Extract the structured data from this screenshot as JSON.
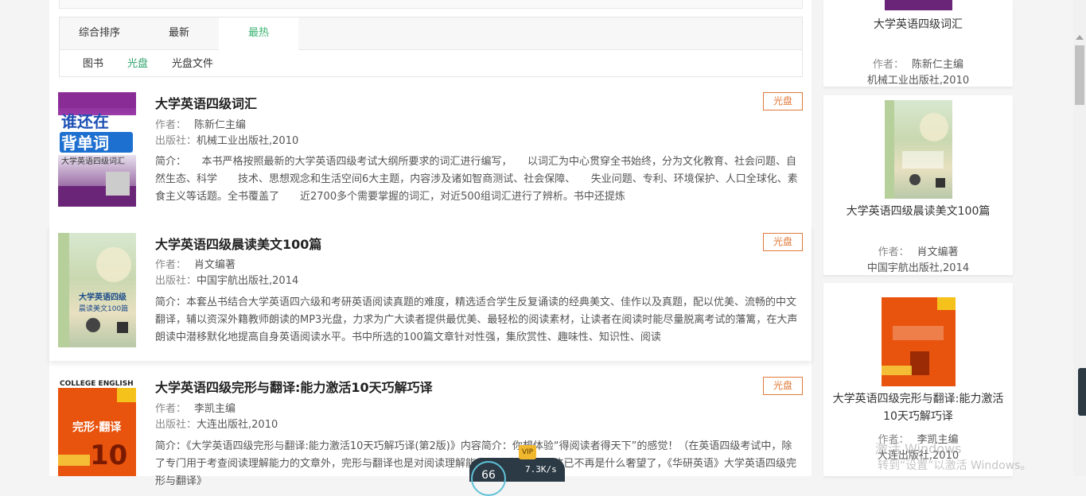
{
  "sort_tabs": [
    "综合排序",
    "最新",
    "最热"
  ],
  "active_sort": "最热",
  "filters": [
    "图书",
    "光盘",
    "光盘文件"
  ],
  "active_filter": "光盘",
  "labels": {
    "author": "作者：",
    "publisher": "出版社：",
    "intro": "简介："
  },
  "books": [
    {
      "title": "大学英语四级词汇",
      "author": "陈新仁主编",
      "publisher": "机械工业出版社,2010",
      "tag": "光盘",
      "intro": "　　本书严格按照最新的大学英语四级考试大纲所要求的词汇进行编写，　　以词汇为中心贯穿全书始终，分为文化教育、社会问题、自然生态、科学　　技术、思想观念和生活空间6大主题，内容涉及诸如智商测试、社会保障、　　失业问题、专利、环境保护、人口全球化、素食主义等话题。全书覆盖了　　近2700多个需要掌握的词汇，对近500组词汇进行了辨析。书中还提炼",
      "cover_text": [
        "谁还在",
        "背单词",
        "大学英语四级词汇"
      ]
    },
    {
      "title": "大学英语四级晨读美文100篇",
      "author": "肖文编著",
      "publisher": "中国宇航出版社,2014",
      "tag": "光盘",
      "intro": "本套丛书结合大学英语四六级和考研英语阅读真题的难度，精选适合学生反复诵读的经典美文、佳作以及真题，配以优美、流畅的中文翻译，辅以资深外籍教师朗读的MP3光盘，力求为广大读者提供最优美、最轻松的阅读素材，让读者在阅读时能尽量脱离考试的藩篱，在大声朗读中潜移默化地提高自身英语阅读水平。书中所选的100篇文章针对性强，集欣赏性、趣味性、知识性、阅读",
      "cover_text": [
        "大学英语四级",
        "晨读美文100篇"
      ]
    },
    {
      "title": "大学英语四级完形与翻译:能力激活10天巧解巧译",
      "author": "李凯主编",
      "publisher": "大连出版社,2010",
      "tag": "光盘",
      "intro": "《大学英语四级完形与翻译:能力激活10天巧解巧译(第2版)》内容简介：你想体验“得阅读者得天下”的感觉！（在英语四级考试中，除了专门用于考查阅读理解能力的文章外，完形与翻译也是对阅读理解能力的考查。）现在这已不再是什么奢望了，《华研英语》大学英语四级完形与翻译》",
      "cover_text": [
        "COLLEGE ENGLISH",
        "完形·翻译",
        "10"
      ]
    }
  ],
  "sidebar": [
    {
      "title": "大学英语四级词汇",
      "author": "陈新仁主编",
      "publisher": "机械工业出版社,2010"
    },
    {
      "title": "大学英语四级晨读美文100篇",
      "author": "肖文编著",
      "publisher": "中国宇航出版社,2014"
    },
    {
      "title": "大学英语四级完形与翻译:能力激活10天巧解巧译",
      "author": "李凯主编",
      "publisher": "大连出版社,2010"
    }
  ],
  "overlay": {
    "speed": "7.3K/s",
    "ring": "66",
    "vip": "VIP",
    "watermark_line1": "激活 Windows",
    "watermark_line2": "转到“设置”以激活 Windows。"
  },
  "colors": {
    "accent_green": "#2fa36b",
    "tag_orange": "#e07a3a"
  }
}
